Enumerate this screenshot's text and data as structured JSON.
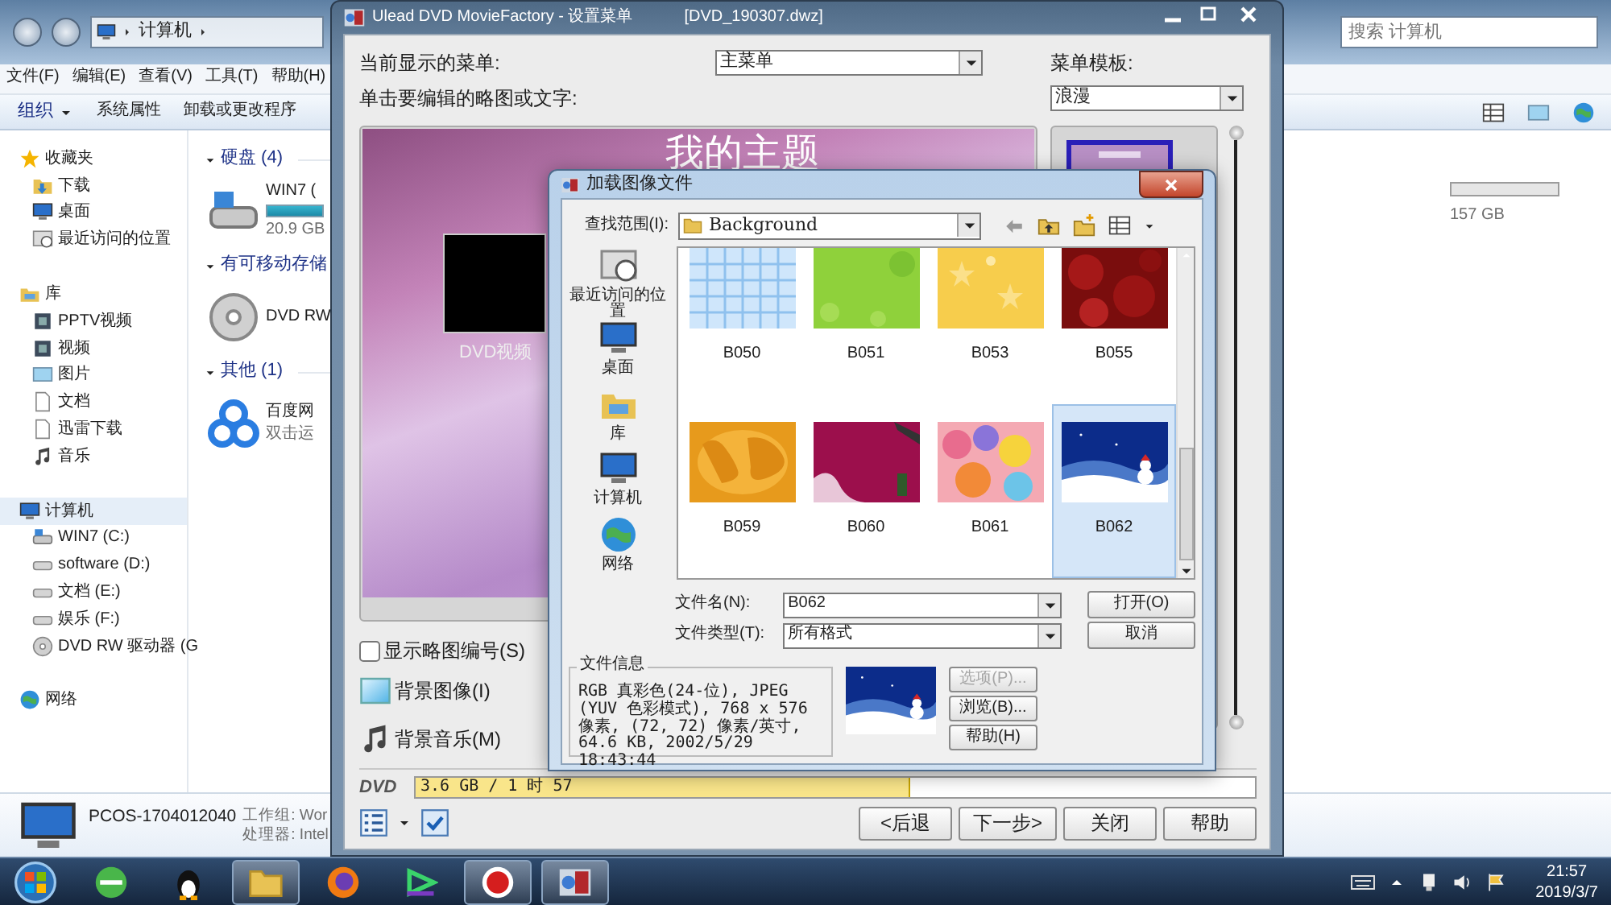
{
  "explorer": {
    "address": [
      "计算机"
    ],
    "search": {
      "placeholder": "搜索 计算机"
    },
    "menu": [
      "文件(F)",
      "编辑(E)",
      "查看(V)",
      "工具(T)",
      "帮助(H)"
    ],
    "toolbar": [
      {
        "label": "组织",
        "kind": "dropdown"
      },
      {
        "label": "系统属性",
        "kind": "button"
      },
      {
        "label": "卸载或更改程序",
        "kind": "button"
      }
    ],
    "nav": [
      {
        "label": "收藏夹",
        "selected": false,
        "children": [
          {
            "label": "下载",
            "selected": false
          },
          {
            "label": "桌面",
            "selected": false
          },
          {
            "label": "最近访问的位置",
            "selected": false
          }
        ]
      },
      {
        "label": "库",
        "selected": false,
        "children": [
          {
            "label": "PPTV视频",
            "selected": false
          },
          {
            "label": "视频",
            "selected": false
          },
          {
            "label": "图片",
            "selected": false
          },
          {
            "label": "文档",
            "selected": false
          },
          {
            "label": "迅雷下载",
            "selected": false
          },
          {
            "label": "音乐",
            "selected": false
          }
        ]
      },
      {
        "label": "计算机",
        "selected": true,
        "children": [
          {
            "label": "WIN7 (C:)",
            "selected": false
          },
          {
            "label": "software (D:)",
            "selected": false
          },
          {
            "label": "文档 (E:)",
            "selected": false
          },
          {
            "label": "娱乐 (F:)",
            "selected": false
          },
          {
            "label": "DVD RW 驱动器 (G",
            "selected": false
          }
        ]
      },
      {
        "label": "网络",
        "selected": false
      }
    ],
    "groups": [
      {
        "title": "硬盘 (4)",
        "items": [
          {
            "name": "WIN7 (",
            "size": "20.9 GB"
          }
        ]
      },
      {
        "title": "有可移动存储",
        "items": [
          {
            "name": "DVD RW"
          }
        ]
      },
      {
        "title": "其他 (1)",
        "items": [
          {
            "name": "百度网",
            "note": "双击运"
          }
        ]
      }
    ],
    "second_column": {
      "size": "157 GB"
    },
    "details": {
      "computer": "PCOS-1704012040",
      "workgroup": "工作组: Wor",
      "processor": "处理器: Intel"
    }
  },
  "ulead": {
    "title": "Ulead DVD MovieFactory - 设置菜单",
    "file": "[DVD_190307.dwz]",
    "current_menu_label": "当前显示的菜单:",
    "current_menu": "主菜单",
    "template_label": "菜单模板:",
    "template": "浪漫",
    "edit_label": "单击要编辑的略图或文字:",
    "preview": {
      "title": "我的主题",
      "caption": "DVD视频"
    },
    "show_numbers": {
      "label": "显示略图编号(S)",
      "checked": false
    },
    "actions": [
      "背景图像(I)",
      "背景音乐(M)"
    ],
    "disc": {
      "label": "DVD",
      "usage": "3.6 GB / 1 时 57",
      "level": 0.59
    },
    "buttons": [
      "<后退",
      "下一步>",
      "关闭",
      "帮助"
    ]
  },
  "dialog": {
    "title": "加载图像文件",
    "look_in_label": "查找范围(I):",
    "look_in": "Background",
    "places": [
      "最近访问的位置",
      "桌面",
      "库",
      "计算机",
      "网络"
    ],
    "files": [
      {
        "name": "B050",
        "selected": false
      },
      {
        "name": "B051",
        "selected": false
      },
      {
        "name": "B053",
        "selected": false
      },
      {
        "name": "B055",
        "selected": false
      },
      {
        "name": "B059",
        "selected": false
      },
      {
        "name": "B060",
        "selected": false
      },
      {
        "name": "B061",
        "selected": false
      },
      {
        "name": "B062",
        "selected": true
      }
    ],
    "filename_label": "文件名(N):",
    "filename": "B062",
    "filetype_label": "文件类型(T):",
    "filetype": "所有格式",
    "open": "打开(O)",
    "cancel": "取消",
    "info_label": "文件信息",
    "info": "RGB 真彩色(24-位), JPEG (YUV 色彩模式), 768 x 576 像素, (72, 72) 像素/英寸, 64.6 KB, 2002/5/29 18:43:44",
    "side_buttons": [
      {
        "label": "选项(P)...",
        "disabled": true
      },
      {
        "label": "浏览(B)...",
        "disabled": false
      },
      {
        "label": "帮助(H)",
        "disabled": false
      }
    ]
  },
  "taskbar": {
    "apps": [
      {
        "running": false
      },
      {
        "running": false
      },
      {
        "running": true
      },
      {
        "running": false
      },
      {
        "running": false
      },
      {
        "running": true
      },
      {
        "running": true
      }
    ],
    "time": "21:57",
    "date": "2019/3/7"
  }
}
